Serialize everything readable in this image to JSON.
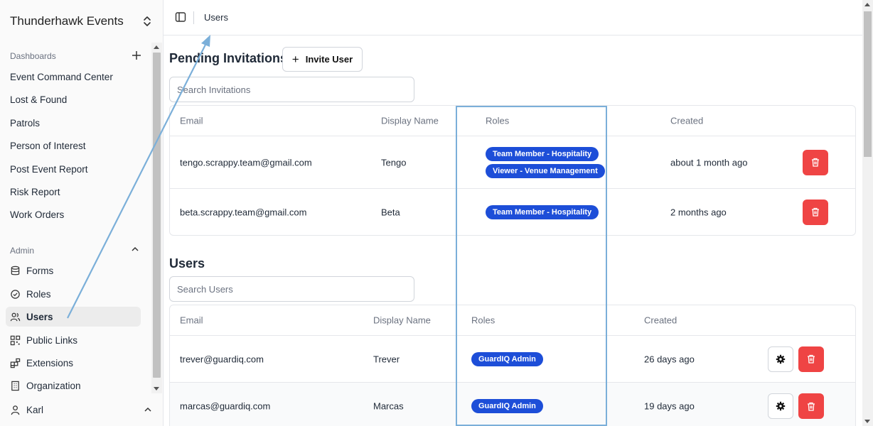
{
  "sidebar": {
    "org_name": "Thunderhawk Events",
    "dashboards": {
      "label": "Dashboards",
      "items": [
        "Event Command Center",
        "Lost & Found",
        "Patrols",
        "Person of Interest",
        "Post Event Report",
        "Risk Report",
        "Work Orders"
      ]
    },
    "admin": {
      "label": "Admin",
      "items": [
        {
          "label": "Forms",
          "icon": "database-icon"
        },
        {
          "label": "Roles",
          "icon": "check-circle-icon"
        },
        {
          "label": "Users",
          "icon": "users-icon",
          "active": true
        },
        {
          "label": "Public Links",
          "icon": "qr-code-icon"
        },
        {
          "label": "Extensions",
          "icon": "blocks-icon"
        },
        {
          "label": "Organization",
          "icon": "building-icon"
        }
      ]
    },
    "user": {
      "name": "Karl"
    }
  },
  "topbar": {
    "breadcrumb": "Users"
  },
  "invitations": {
    "title": "Pending Invitations",
    "invite_button": "Invite User",
    "search_placeholder": "Search Invitations",
    "columns": [
      "Email",
      "Display Name",
      "Roles",
      "Created"
    ],
    "rows": [
      {
        "email": "tengo.scrappy.team@gmail.com",
        "name": "Tengo",
        "roles": [
          "Team Member - Hospitality",
          "Viewer - Venue Management"
        ],
        "created": "about 1 month ago"
      },
      {
        "email": "beta.scrappy.team@gmail.com",
        "name": "Beta",
        "roles": [
          "Team Member - Hospitality"
        ],
        "created": "2 months ago"
      }
    ]
  },
  "users": {
    "title": "Users",
    "search_placeholder": "Search Users",
    "columns": [
      "Email",
      "Display Name",
      "Roles",
      "Created"
    ],
    "rows": [
      {
        "email": "trever@guardiq.com",
        "name": "Trever",
        "roles": [
          "GuardIQ Admin"
        ],
        "created": "26 days ago"
      },
      {
        "email": "marcas@guardiq.com",
        "name": "Marcas",
        "roles": [
          "GuardIQ Admin"
        ],
        "created": "19 days ago"
      }
    ]
  },
  "colors": {
    "accent_badge": "#1d4ed8",
    "danger": "#ef4444",
    "annotation": "#7bafd9"
  }
}
